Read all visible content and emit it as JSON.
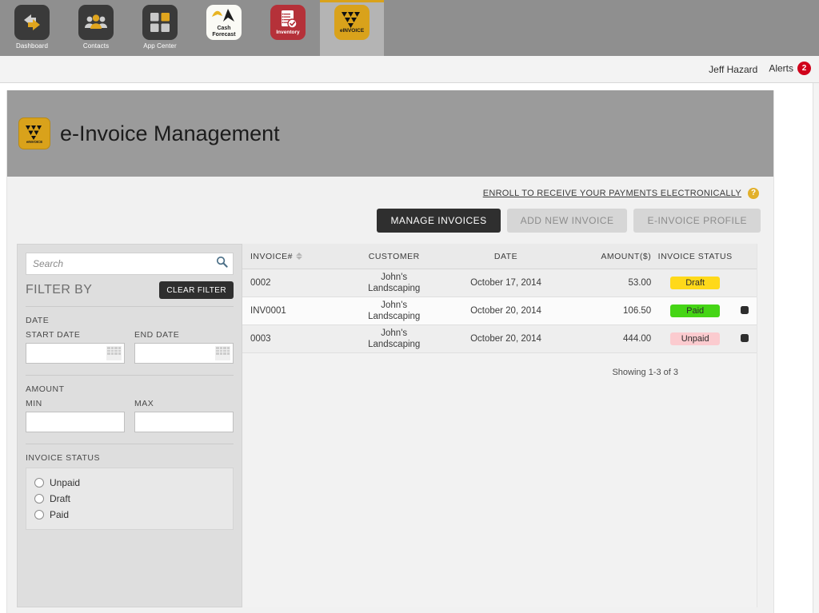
{
  "appbar": {
    "tiles": [
      {
        "label": "Dashboard",
        "icon": "dashboard-icon",
        "style": "dark",
        "active": false
      },
      {
        "label": "Contacts",
        "icon": "contacts-icon",
        "style": "dark",
        "active": false
      },
      {
        "label": "App Center",
        "icon": "app-center-icon",
        "style": "dark",
        "active": false
      },
      {
        "label": "Cash\nForecast",
        "icon": "cash-forecast-icon",
        "style": "white",
        "active": false
      },
      {
        "label": "Inventory",
        "icon": "inventory-icon",
        "style": "red",
        "active": false
      },
      {
        "label": "eINVOICE",
        "icon": "einvoice-icon",
        "style": "gold",
        "active": true
      }
    ]
  },
  "userbar": {
    "user_name": "Jeff Hazard",
    "alerts_label": "Alerts",
    "alerts_count": "2"
  },
  "banner": {
    "title": "e-Invoice Management",
    "logo_label": "eINVOICE",
    "logo_icon": "einvoice-icon"
  },
  "actions": {
    "enroll_link": "ENROLL TO RECEIVE YOUR PAYMENTS ELECTRONICALLY",
    "help_icon_glyph": "?",
    "tabs": [
      {
        "label": "MANAGE INVOICES",
        "active": true
      },
      {
        "label": "ADD NEW INVOICE",
        "active": false
      },
      {
        "label": "E-INVOICE PROFILE",
        "active": false
      }
    ]
  },
  "sidebar": {
    "search_placeholder": "Search",
    "search_value": "",
    "search_icon": "search-icon",
    "filter_title": "FILTER BY",
    "clear_filter_label": "CLEAR FILTER",
    "date_section_label": "DATE",
    "start_date_label": "START DATE",
    "start_date_value": "",
    "end_date_label": "END DATE",
    "end_date_value": "",
    "amount_section_label": "AMOUNT",
    "min_label": "MIN",
    "min_value": "",
    "max_label": "MAX",
    "max_value": "",
    "status_section_label": "INVOICE STATUS",
    "status_options": [
      {
        "label": "Unpaid",
        "selected": false
      },
      {
        "label": "Draft",
        "selected": false
      },
      {
        "label": "Paid",
        "selected": false
      }
    ]
  },
  "table": {
    "columns": [
      {
        "key": "invoice",
        "label": "INVOICE#",
        "sortable": true
      },
      {
        "key": "customer",
        "label": "CUSTOMER",
        "sortable": false
      },
      {
        "key": "date",
        "label": "DATE",
        "sortable": false
      },
      {
        "key": "amount",
        "label": "AMOUNT($)",
        "sortable": false
      },
      {
        "key": "status",
        "label": "INVOICE STATUS",
        "sortable": false
      },
      {
        "key": "actions",
        "label": "",
        "sortable": false
      }
    ],
    "rows": [
      {
        "invoice": "0002",
        "customer": "John&#039;s Landscaping",
        "date": "October 17, 2014",
        "amount": "53.00",
        "status": "Draft",
        "status_kind": "draft",
        "has_action": false
      },
      {
        "invoice": "INV0001",
        "customer": "John&#039;s Landscaping",
        "date": "October 20, 2014",
        "amount": "106.50",
        "status": "Paid",
        "status_kind": "paid",
        "has_action": true
      },
      {
        "invoice": "0003",
        "customer": "John&#039;s Landscaping",
        "date": "October 20, 2014",
        "amount": "444.00",
        "status": "Unpaid",
        "status_kind": "unpaid",
        "has_action": true
      }
    ],
    "showing_text": "Showing 1-3 of 3"
  },
  "colors": {
    "brand_gold": "#d9a21b",
    "alert_red": "#d0021b",
    "status_draft": "#ffd91a",
    "status_paid": "#45d515",
    "status_unpaid": "#fbcbcf",
    "active_tab": "#2f2f2f",
    "inactive_tab": "#d6d6d6",
    "banner_gray": "#9b9b9b"
  }
}
